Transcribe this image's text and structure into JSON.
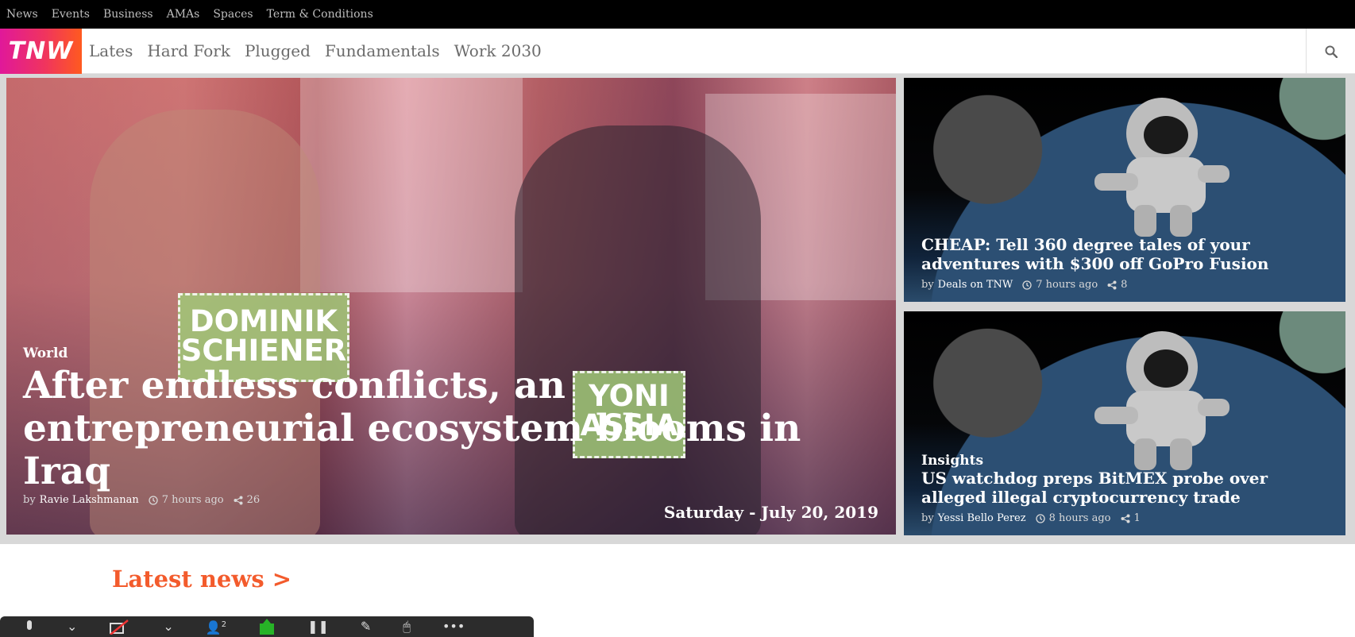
{
  "topbar": {
    "links": [
      "News",
      "Events",
      "Business",
      "AMAs",
      "Spaces",
      "Term & Conditions"
    ]
  },
  "nav": {
    "logo_text": "TNW",
    "links": [
      "Lates",
      "Hard Fork",
      "Plugged",
      "Fundamentals",
      "Work 2030"
    ],
    "search_icon": "search-icon"
  },
  "hero": {
    "category": "World",
    "title": "After endless conflicts, an entrepreneurial ecosystem blooms in Iraq",
    "by": "by",
    "author": "Ravie Lakshmanan",
    "time": "7 hours ago",
    "shares": "26",
    "date": "Saturday - July 20, 2019",
    "label_left": "DOMINIK\nSCHIENER",
    "label_right": "YONI\nASSIA"
  },
  "side_cards": [
    {
      "category": "",
      "title": "CHEAP: Tell 360 degree tales of your adventures with $300 off GoPro Fusion",
      "by": "by",
      "author": "Deals on TNW",
      "time": "7 hours ago",
      "shares": "8"
    },
    {
      "category": "Insights",
      "title": "US watchdog preps BitMEX probe over alleged illegal cryptocurrency trade",
      "by": "by",
      "author": "Yessi Bello Perez",
      "time": "8 hours ago",
      "shares": "1"
    }
  ],
  "latest": {
    "label": "Latest news >"
  },
  "zoom_toolbar": {
    "participants_count": "2"
  },
  "colors": {
    "accent": "#f35b2c",
    "logo_start": "#e0189a",
    "logo_end": "#ff5a1f"
  }
}
